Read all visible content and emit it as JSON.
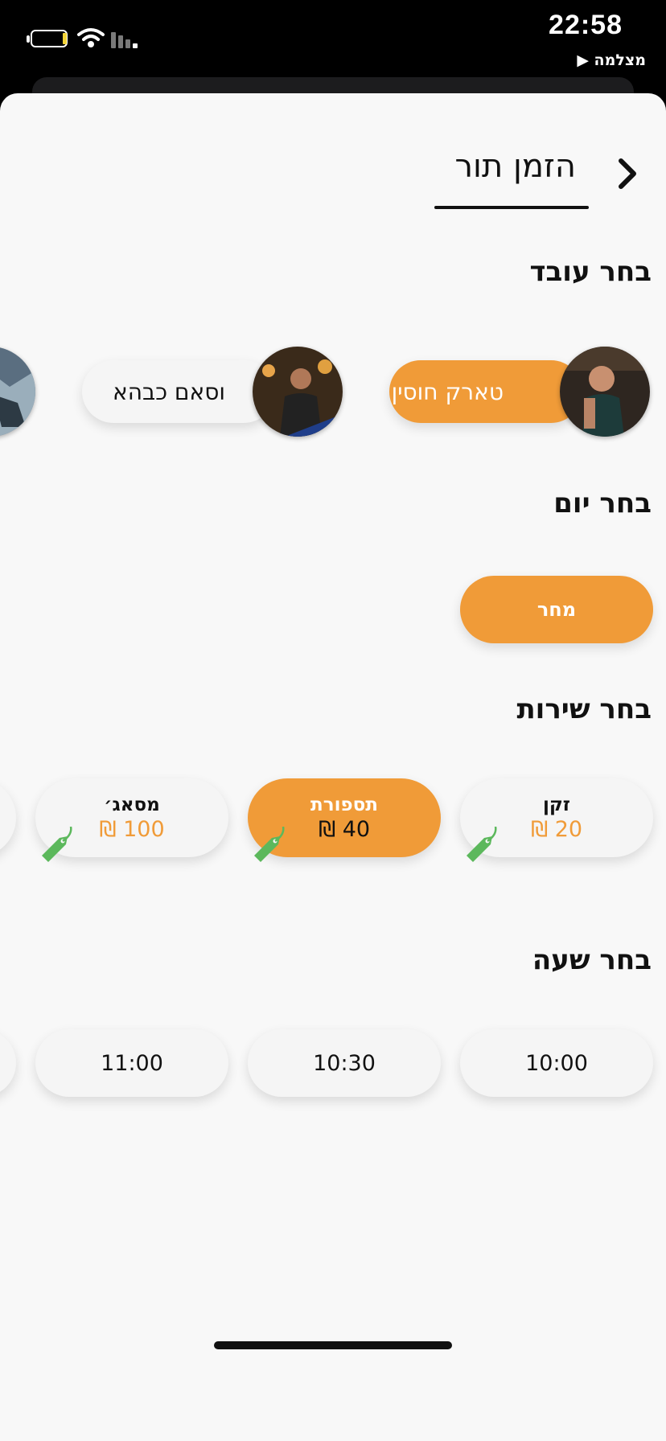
{
  "status_bar": {
    "time": "22:58",
    "back_app": "מצלמה ▶"
  },
  "header": {
    "title": "הזמן תור"
  },
  "sections": {
    "employee": "בחר עובד",
    "day": "בחר יום",
    "service": "בחר שירות",
    "hour": "בחר שעה"
  },
  "employees": [
    {
      "name": "טארק חוסין",
      "selected": true
    },
    {
      "name": "וסאם כבהא",
      "selected": false
    }
  ],
  "days": [
    {
      "label": "מחר",
      "selected": true
    }
  ],
  "services": [
    {
      "name": "זקן",
      "price": "20 ₪",
      "selected": false
    },
    {
      "name": "תספורת",
      "price": "40 ₪",
      "selected": true
    },
    {
      "name": "מסאג׳",
      "price": "100 ₪",
      "selected": false
    }
  ],
  "times": [
    "10:00",
    "10:30",
    "11:00"
  ],
  "colors": {
    "accent": "#f09b38",
    "tag": "#5cb85c",
    "pill": "#f5f5f5"
  }
}
